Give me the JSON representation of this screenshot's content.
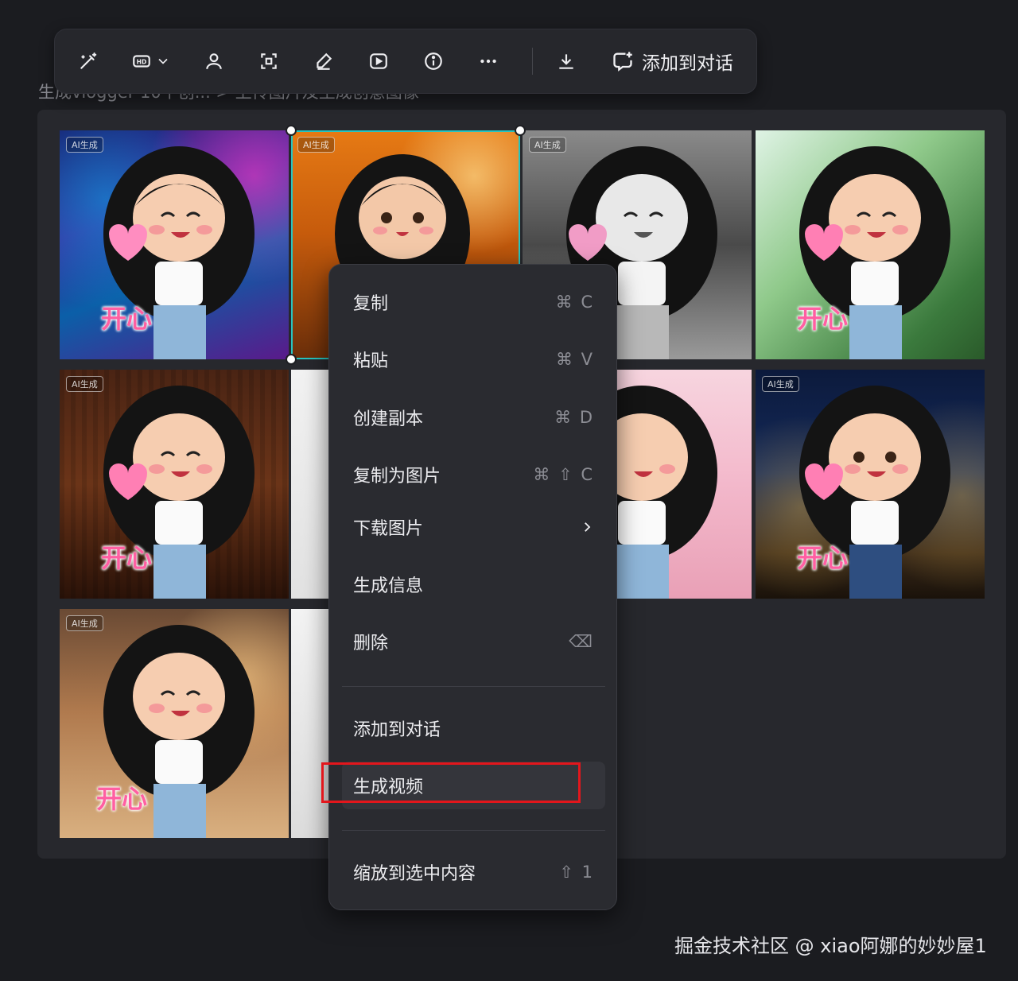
{
  "breadcrumb": "生成vlogger 10个创... > 上传图片及生成创意图像",
  "toolbar": {
    "icons": [
      "magic-wand-icon",
      "hd-icon",
      "chevron-down-icon",
      "person-cutout-icon",
      "focus-scan-icon",
      "eraser-icon",
      "play-icon",
      "info-icon",
      "more-icon",
      "download-icon",
      "add-chat-icon"
    ],
    "add_to_chat_label": "添加到对话"
  },
  "tiles": {
    "ai_tag": "AI生成",
    "caption": "开心"
  },
  "menu": {
    "copy": {
      "label": "复制",
      "shortcut": "⌘ C"
    },
    "paste": {
      "label": "粘贴",
      "shortcut": "⌘ V"
    },
    "duplicate": {
      "label": "创建副本",
      "shortcut": "⌘ D"
    },
    "copy_as_image": {
      "label": "复制为图片",
      "shortcut": "⌘ ⇧ C"
    },
    "download_image": {
      "label": "下载图片"
    },
    "gen_info": {
      "label": "生成信息"
    },
    "delete": {
      "label": "删除",
      "shortcut": "⌫"
    },
    "add_to_chat": {
      "label": "添加到对话"
    },
    "generate_video": {
      "label": "生成视频"
    },
    "zoom_to_selection": {
      "label": "缩放到选中内容",
      "shortcut": "⇧ 1"
    }
  },
  "highlight_color": "#e3161c",
  "selection_color": "#27c4c0",
  "watermark": "掘金技术社区 @ xiao阿娜的妙妙屋1"
}
